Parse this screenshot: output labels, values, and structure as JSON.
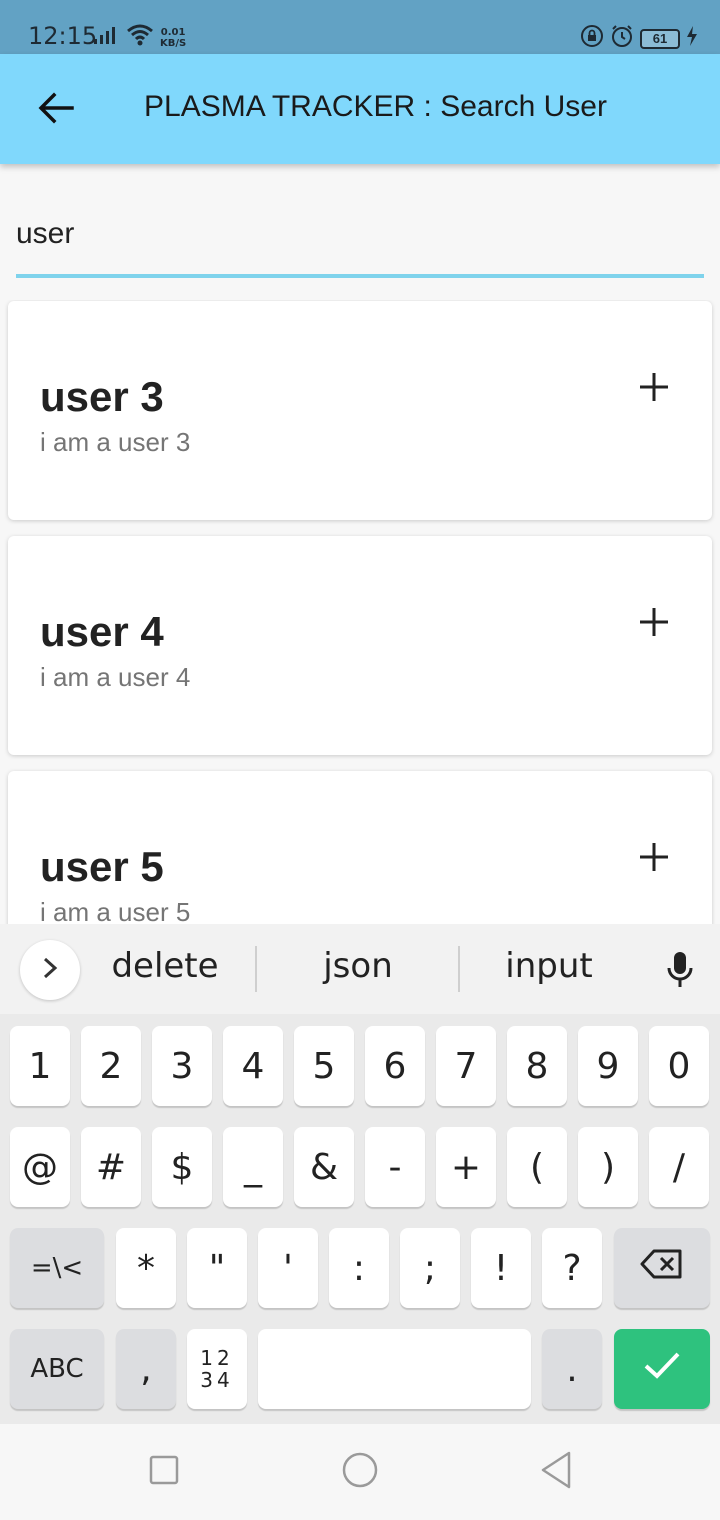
{
  "status_bar": {
    "time": "12:15",
    "net_speed_value": "0.01",
    "net_speed_unit": "KB/S",
    "battery": "61"
  },
  "app_bar": {
    "title": "PLASMA TRACKER : Search User"
  },
  "search": {
    "value": "user"
  },
  "results": [
    {
      "name": "user 3",
      "description": "i am a user 3"
    },
    {
      "name": "user 4",
      "description": "i am a user 4"
    },
    {
      "name": "user 5",
      "description": "i am a user 5"
    }
  ],
  "keyboard": {
    "suggestions": [
      "delete",
      "json",
      "input"
    ],
    "row1": [
      "1",
      "2",
      "3",
      "4",
      "5",
      "6",
      "7",
      "8",
      "9",
      "0"
    ],
    "row2": [
      "@",
      "#",
      "$",
      "_",
      "&",
      "-",
      "+",
      "(",
      ")",
      "/"
    ],
    "row3": [
      "=\\<",
      "*",
      "\"",
      "'",
      ":",
      ";",
      "!",
      "?"
    ],
    "abc_label": "ABC",
    "comma_label": ",",
    "num_label_top": "12",
    "num_label_bottom": "34",
    "period_label": "."
  },
  "colors": {
    "app_bar": "#80d8fc",
    "status_bar": "#62a2c4",
    "underline": "#7fd3ec",
    "done_key": "#2ec27e"
  }
}
